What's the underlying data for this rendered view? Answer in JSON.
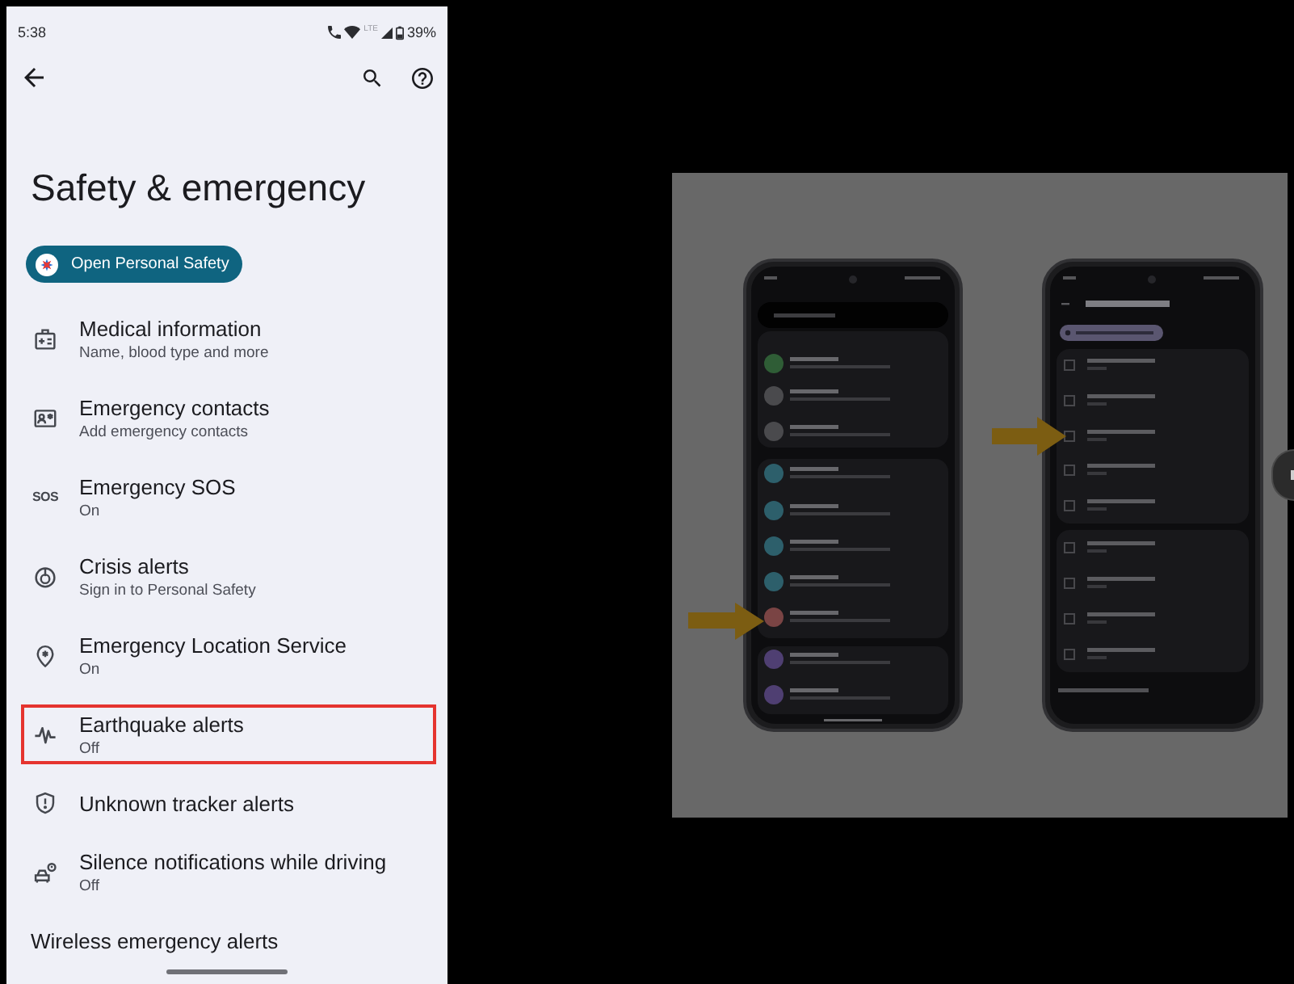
{
  "status_bar": {
    "time": "5:38",
    "network": "LTE",
    "battery": "39%"
  },
  "header": {
    "title": "Safety & emergency"
  },
  "personal_safety_button": {
    "label": "Open Personal Safety"
  },
  "items": [
    {
      "title": "Medical information",
      "subtitle": "Name, blood type and more",
      "highlighted": false
    },
    {
      "title": "Emergency contacts",
      "subtitle": "Add emergency contacts",
      "highlighted": false
    },
    {
      "title": "Emergency SOS",
      "subtitle": "On",
      "icon_text": "SOS",
      "highlighted": false
    },
    {
      "title": "Crisis alerts",
      "subtitle": "Sign in to Personal Safety",
      "highlighted": false
    },
    {
      "title": "Emergency Location Service",
      "subtitle": "On",
      "highlighted": false
    },
    {
      "title": "Earthquake alerts",
      "subtitle": "Off",
      "highlighted": true
    },
    {
      "title": "Unknown tracker alerts",
      "highlighted": false
    },
    {
      "title": "Silence notifications while driving",
      "subtitle": "Off",
      "highlighted": false
    }
  ],
  "wireless_alerts": {
    "label": "Wireless emergency alerts"
  }
}
